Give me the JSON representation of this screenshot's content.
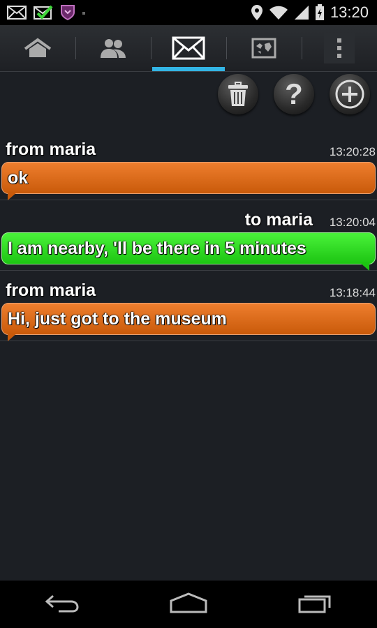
{
  "status_bar": {
    "time": "13:20",
    "icons": [
      "mail-icon",
      "mail-check-icon",
      "shield-icon",
      "location-icon",
      "wifi-icon",
      "signal-icon",
      "battery-icon"
    ]
  },
  "tabs": [
    {
      "name": "home",
      "icon": "home-icon",
      "active": false
    },
    {
      "name": "contacts",
      "icon": "contacts-icon",
      "active": false
    },
    {
      "name": "messages",
      "icon": "envelope-icon",
      "active": true
    },
    {
      "name": "map",
      "icon": "map-icon",
      "active": false
    },
    {
      "name": "menu",
      "icon": "overflow-menu-icon",
      "active": false
    }
  ],
  "actions": [
    "trash-icon",
    "help-icon",
    "add-icon"
  ],
  "messages": [
    {
      "direction": "from",
      "label": "from  maria",
      "time": "13:20:28",
      "text": "ok"
    },
    {
      "direction": "to",
      "label": "to  maria",
      "time": "13:20:04",
      "text": "I am nearby, 'll be there in 5 minutes"
    },
    {
      "direction": "from",
      "label": "from  maria",
      "time": "13:18:44",
      "text": "Hi, just got to the museum"
    }
  ],
  "colors": {
    "accent": "#33b5e5",
    "incoming_bubble": "#d9661a",
    "outgoing_bubble": "#2ed822"
  },
  "nav": [
    "back-icon",
    "home-nav-icon",
    "recents-icon"
  ]
}
